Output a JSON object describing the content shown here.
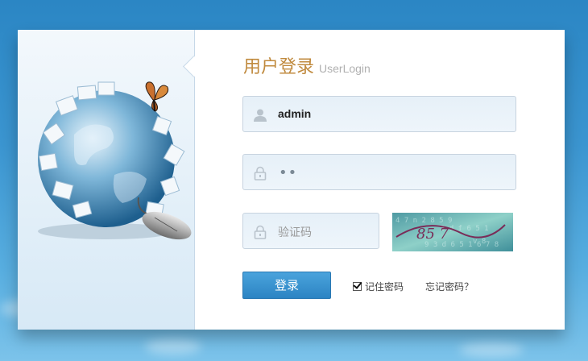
{
  "login": {
    "title_zh": "用户登录",
    "title_en": "UserLogin",
    "username_value": "admin",
    "password_value": "••",
    "captcha_placeholder": "验证码",
    "captcha_text": "85 7",
    "submit_label": "登录",
    "remember_label": "记住密码",
    "remember_checked": true,
    "forgot_label": "忘记密码？"
  },
  "colors": {
    "title_accent": "#c08a3e",
    "button": "#2c84c3",
    "background": "#3b95d0"
  },
  "icons": {
    "user": "user-icon",
    "lock": "lock-icon",
    "globe": "puzzle-globe-illustration",
    "butterfly": "butterfly-icon",
    "mouse": "computer-mouse-icon"
  }
}
